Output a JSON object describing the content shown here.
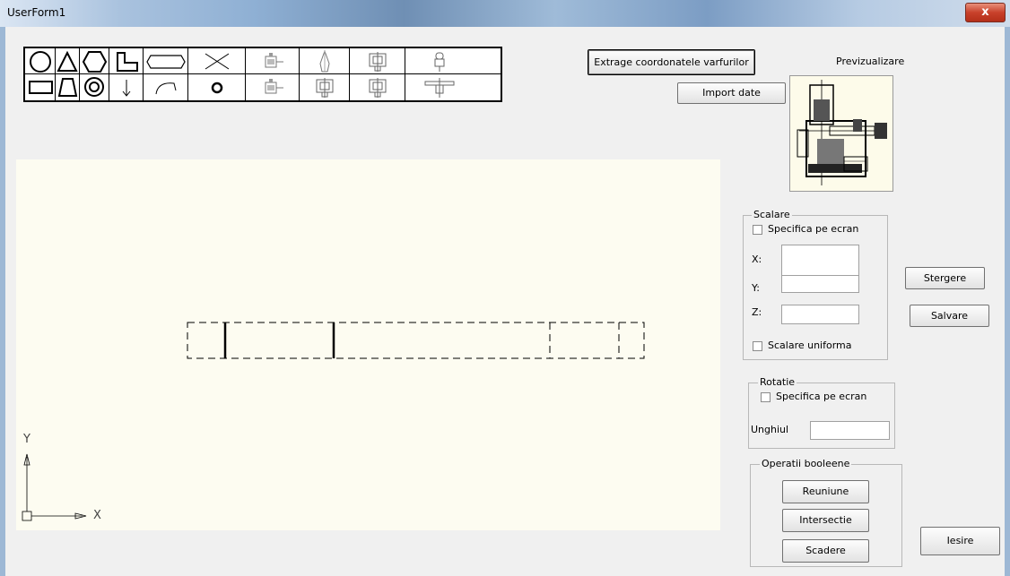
{
  "window": {
    "title": "UserForm1",
    "close_glyph": "x"
  },
  "palette": {
    "row1": [
      "circle-icon",
      "triangle-icon",
      "hexagon-icon",
      "l-profile-icon",
      "rounded-slot-icon",
      "cross-icon",
      "part-view-1-icon",
      "tapered-part-icon",
      "flange-part-icon",
      "valve-part-icon"
    ],
    "row2": [
      "rectangle-icon",
      "trapezoid-icon",
      "concentric-circles-icon",
      "arrow-down-icon",
      "arc-icon",
      "small-circle-icon",
      "part-view-2-icon",
      "flange-part-2-icon",
      "flange-part-3-icon",
      "valve-part-2-icon"
    ]
  },
  "buttons": {
    "extract": "Extrage coordonatele varfurilor",
    "import": "Import date",
    "delete": "Stergere",
    "save": "Salvare",
    "union": "Reuniune",
    "intersection": "Intersectie",
    "subtraction": "Scadere",
    "exit": "Iesire"
  },
  "preview": {
    "label": "Previzualizare"
  },
  "scaling": {
    "title": "Scalare",
    "specify_on_screen": "Specifica pe ecran",
    "x_label": "X:",
    "y_label": "Y:",
    "z_label": "Z:",
    "x_value": "",
    "y_value": "",
    "z_value": "",
    "uniform": "Scalare uniforma"
  },
  "rotation": {
    "title": "Rotatie",
    "specify_on_screen": "Specifica pe ecran",
    "angle_label": "Unghiul",
    "angle_value": ""
  },
  "boolean_ops": {
    "title": "Operatii booleene"
  },
  "axes": {
    "y": "Y",
    "x": "X"
  }
}
